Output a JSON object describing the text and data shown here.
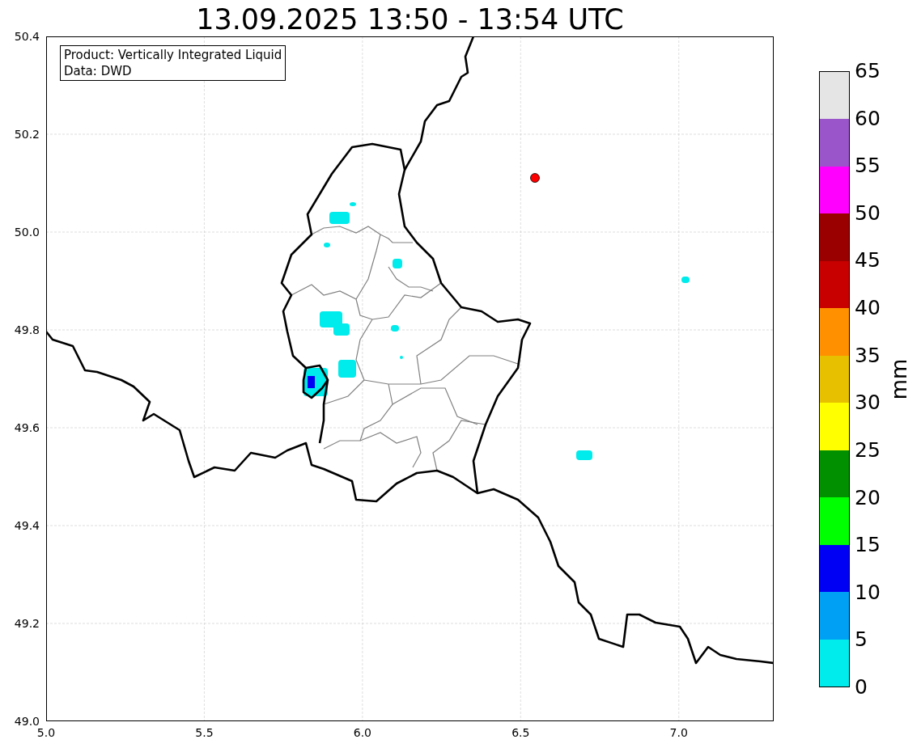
{
  "title": "13.09.2025 13:50 - 13:54 UTC",
  "legend": [
    "Product: Vertically Integrated Liquid",
    "Data: DWD"
  ],
  "map": {
    "xticks": [
      "5.0",
      "5.5",
      "6.0",
      "6.5",
      "7.0"
    ],
    "yticks": [
      "50.4",
      "50.2",
      "50.0",
      "49.8",
      "49.6",
      "49.4",
      "49.2",
      "49.0"
    ]
  },
  "colorbar": {
    "label": "mm",
    "ticks": [
      "65",
      "60",
      "55",
      "50",
      "45",
      "40",
      "35",
      "30",
      "25",
      "20",
      "15",
      "10",
      "5",
      "0"
    ],
    "segments": [
      {
        "color": "#e5e5e5"
      },
      {
        "color": "#9955c9"
      },
      {
        "color": "#ff00ff"
      },
      {
        "color": "#9a0000"
      },
      {
        "color": "#c80000"
      },
      {
        "color": "#ff9000"
      },
      {
        "color": "#e7c000"
      },
      {
        "color": "#ffff00"
      },
      {
        "color": "#009000"
      },
      {
        "color": "#00ff00"
      },
      {
        "color": "#0000f5"
      },
      {
        "color": "#00a0f5"
      },
      {
        "color": "#00ebeb"
      }
    ]
  }
}
